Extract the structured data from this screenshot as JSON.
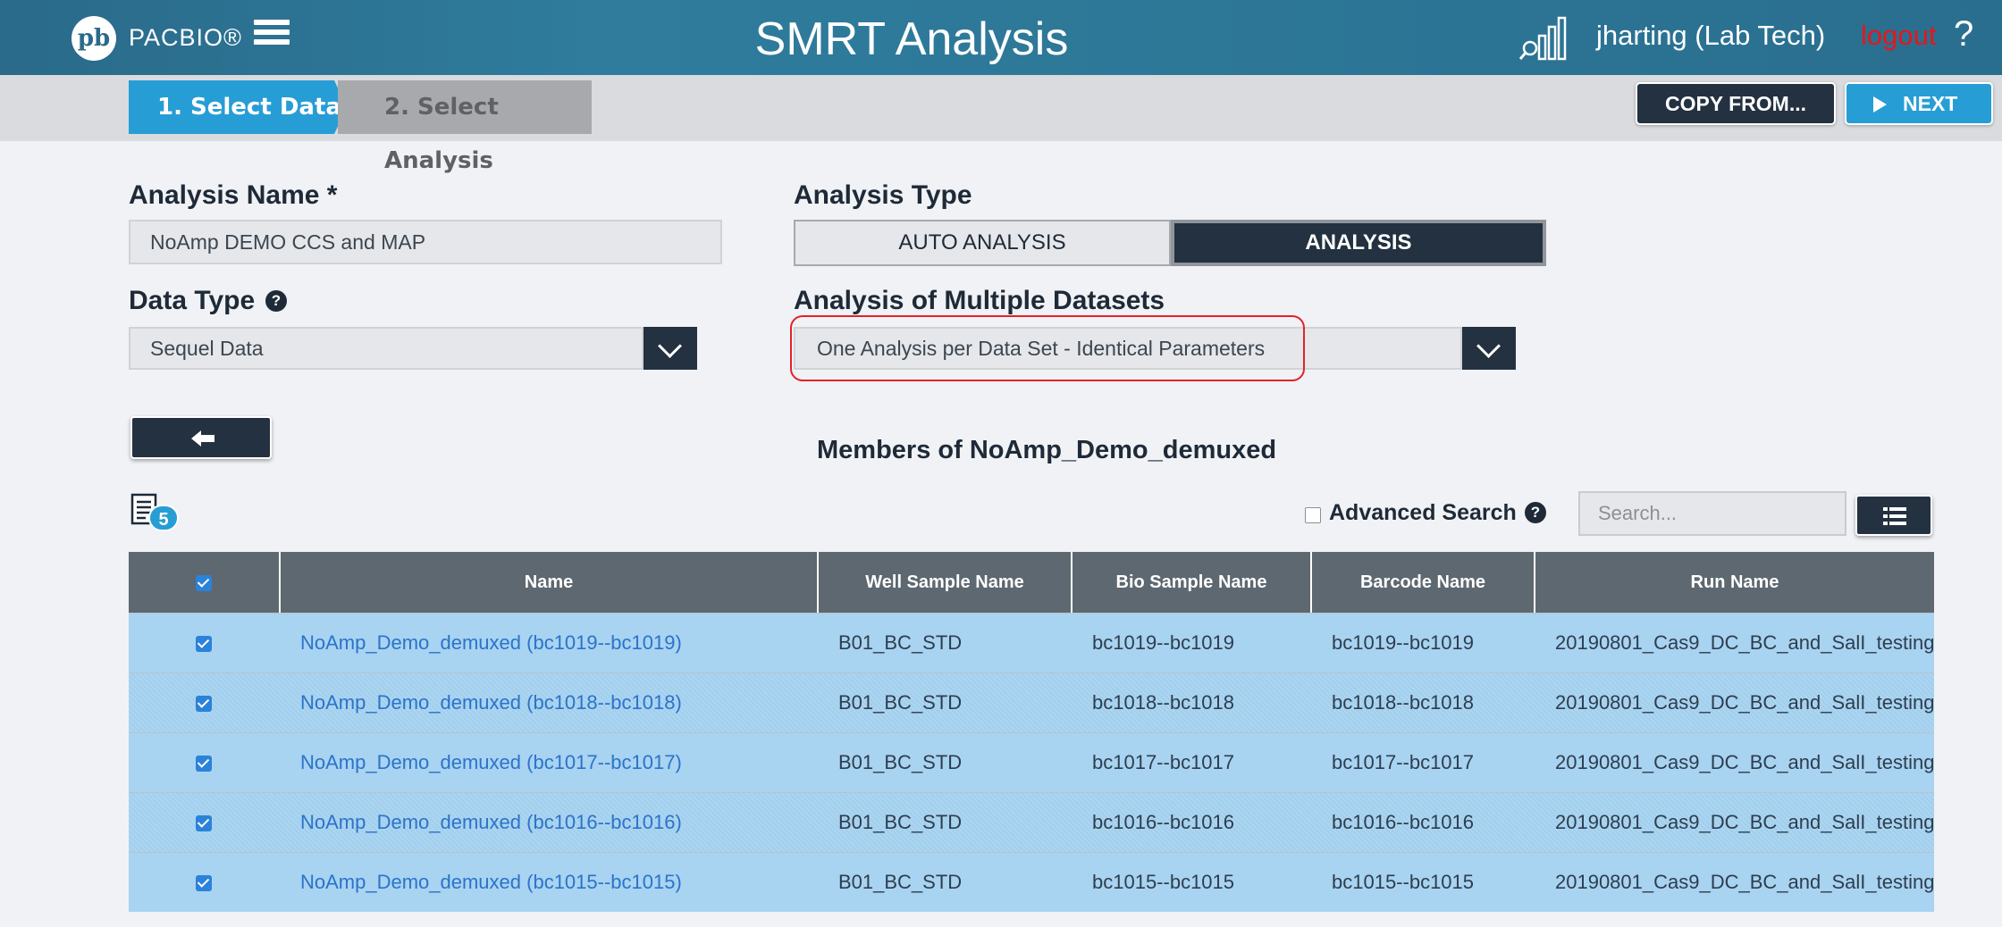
{
  "header": {
    "logo_mark": "pb",
    "logo_text": "PACBIO®",
    "app_title": "SMRT Analysis",
    "user": "jharting (Lab Tech)",
    "logout": "logout",
    "help": "?"
  },
  "wizard": {
    "step1": "1. Select Data",
    "step2": "2. Select Analysis",
    "copy_from": "COPY FROM...",
    "next": "NEXT"
  },
  "form": {
    "analysis_name_label": "Analysis Name *",
    "analysis_name_value": "NoAmp DEMO CCS and MAP",
    "analysis_type_label": "Analysis Type",
    "type_auto": "AUTO ANALYSIS",
    "type_analysis": "ANALYSIS",
    "data_type_label": "Data Type",
    "data_type_value": "Sequel Data",
    "multi_label": "Analysis of Multiple Datasets",
    "multi_value": "One Analysis per Data Set - Identical Parameters"
  },
  "members": {
    "title": "Members of NoAmp_Demo_demuxed",
    "count": "5",
    "advanced_search": "Advanced Search",
    "search_placeholder": "Search..."
  },
  "table": {
    "headers": [
      "Name",
      "Well Sample Name",
      "Bio Sample Name",
      "Barcode Name",
      "Run Name"
    ],
    "rows": [
      {
        "name": "NoAmp_Demo_demuxed (bc1019--bc1019)",
        "well": "B01_BC_STD",
        "bio": "bc1019--bc1019",
        "barcode": "bc1019--bc1019",
        "run": "20190801_Cas9_DC_BC_and_SalI_testing"
      },
      {
        "name": "NoAmp_Demo_demuxed (bc1018--bc1018)",
        "well": "B01_BC_STD",
        "bio": "bc1018--bc1018",
        "barcode": "bc1018--bc1018",
        "run": "20190801_Cas9_DC_BC_and_SalI_testing"
      },
      {
        "name": "NoAmp_Demo_demuxed (bc1017--bc1017)",
        "well": "B01_BC_STD",
        "bio": "bc1017--bc1017",
        "barcode": "bc1017--bc1017",
        "run": "20190801_Cas9_DC_BC_and_SalI_testing"
      },
      {
        "name": "NoAmp_Demo_demuxed (bc1016--bc1016)",
        "well": "B01_BC_STD",
        "bio": "bc1016--bc1016",
        "barcode": "bc1016--bc1016",
        "run": "20190801_Cas9_DC_BC_and_SalI_testing"
      },
      {
        "name": "NoAmp_Demo_demuxed (bc1015--bc1015)",
        "well": "B01_BC_STD",
        "bio": "bc1015--bc1015",
        "barcode": "bc1015--bc1015",
        "run": "20190801_Cas9_DC_BC_and_SalI_testing"
      }
    ]
  },
  "colors": {
    "header_bg": "#2a6a8a",
    "accent_blue": "#279dd5",
    "dark_navy": "#233140",
    "row_bg": "#a8d3f1",
    "logout_red": "#e8151b",
    "highlight_red": "#e3222a"
  }
}
